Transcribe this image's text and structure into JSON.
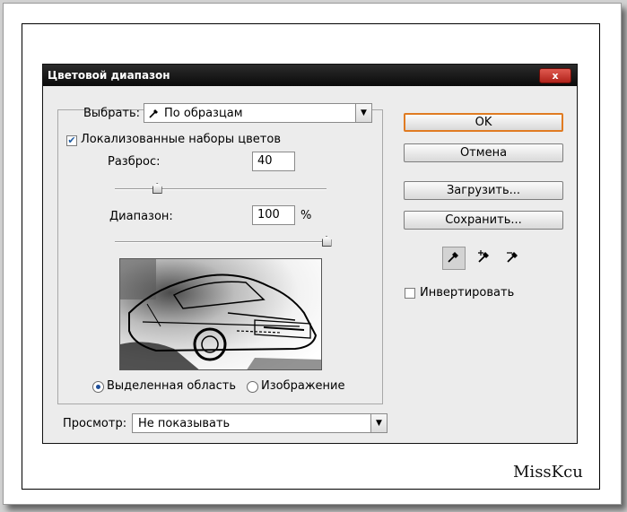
{
  "dialog": {
    "title": "Цветовой диапазон",
    "close_label": "x",
    "select_label": "Выбрать:",
    "select_value": "По образцам",
    "localized_label": "Локализованные наборы цветов",
    "localized_checked": true,
    "fuzziness_label": "Разброс:",
    "fuzziness_value": "40",
    "fuzziness_level": 0.2,
    "range_label": "Диапазон:",
    "range_value": "100",
    "range_unit": "%",
    "range_level": 1.0,
    "radio_selection_label": "Выделенная область",
    "radio_image_label": "Изображение",
    "radio_selected": "selection",
    "preview_label": "Просмотр:",
    "preview_value": "Не показывать",
    "buttons": {
      "ok": "OK",
      "cancel": "Отмена",
      "load": "Загрузить...",
      "save": "Сохранить..."
    },
    "tools": [
      "eyedropper-icon",
      "eyedropper-plus-icon",
      "eyedropper-minus-icon"
    ],
    "invert_label": "Инвертировать",
    "invert_checked": false
  },
  "watermark": "MissKcu",
  "colors": {
    "titlebar": "#111111",
    "close_button": "#c4342a",
    "primary_border": "#e07b22",
    "dialog_bg": "#ececec"
  }
}
